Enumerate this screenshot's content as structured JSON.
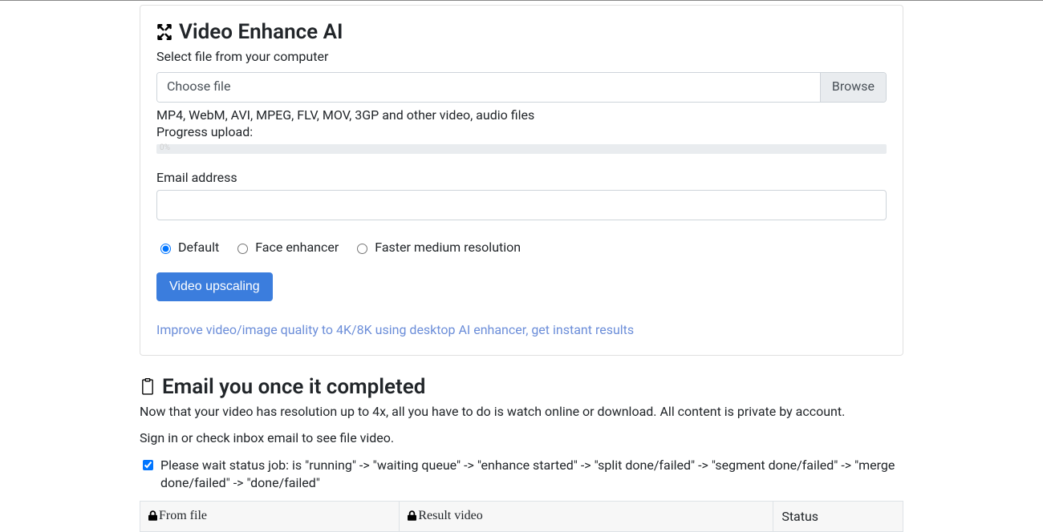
{
  "upload": {
    "title": "Video Enhance AI",
    "subtitle": "Select file from your computer",
    "choose_label": "Choose file",
    "browse_label": "Browse",
    "formats_hint": "MP4, WebM, AVI, MPEG, FLV, MOV, 3GP and other video, audio files",
    "progress_label": "Progress upload:",
    "progress_pct": "0%",
    "email_label": "Email address",
    "email_value": "",
    "options": {
      "default": "Default",
      "face": "Face enhancer",
      "faster": "Faster medium resolution",
      "selected": "default"
    },
    "submit_label": "Video upscaling",
    "promo_link": "Improve video/image quality to 4K/8K using desktop AI enhancer, get instant results"
  },
  "results": {
    "title": "Email you once it completed",
    "intro": "Now that your video has resolution up to 4x, all you have to do is watch online or download. All content is private by account.",
    "signin_note": "Sign in or check inbox email to see file video.",
    "status_text": "Please wait status job: is \"running\" -> \"waiting queue\" -> \"enhance started\" -> \"split done/failed\" -> \"segment done/failed\" -> \"merge done/failed\" -> \"done/failed\"",
    "status_checked": true,
    "table": {
      "headers": {
        "from": "From file",
        "result": "Result video",
        "status": "Status"
      },
      "rows": []
    }
  }
}
